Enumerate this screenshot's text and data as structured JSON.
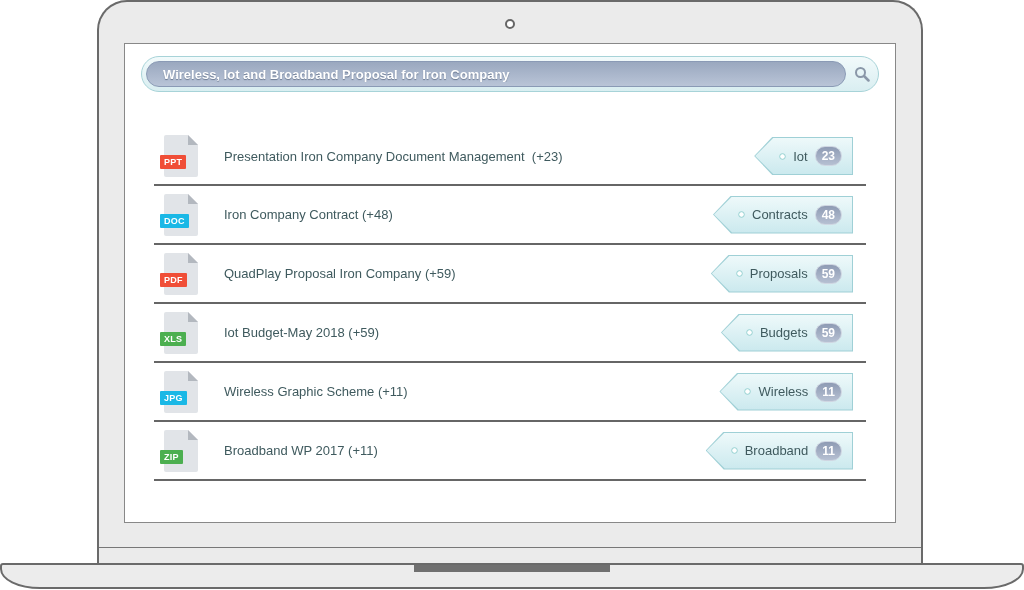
{
  "search": {
    "value": "Wireless, Iot and Broadband Proposal for Iron Company"
  },
  "results": [
    {
      "file_type": "PPT",
      "color": "#f04e37",
      "title": "Presentation Iron Company Document Management  (+23)",
      "tag": "Iot",
      "count": "23"
    },
    {
      "file_type": "DOC",
      "color": "#1ab8e6",
      "title": "Iron Company Contract (+48)",
      "tag": "Contracts",
      "count": "48"
    },
    {
      "file_type": "PDF",
      "color": "#f04e37",
      "title": "QuadPlay Proposal Iron Company (+59)",
      "tag": "Proposals",
      "count": "59"
    },
    {
      "file_type": "XLS",
      "color": "#4caf50",
      "title": "Iot Budget-May 2018 (+59)",
      "tag": "Budgets",
      "count": "59"
    },
    {
      "file_type": "JPG",
      "color": "#1ab8e6",
      "title": "Wireless Graphic Scheme (+11)",
      "tag": "Wireless",
      "count": "11"
    },
    {
      "file_type": "ZIP",
      "color": "#4caf50",
      "title": "Broadband WP 2017 (+11)",
      "tag": "Broadband",
      "count": "11"
    }
  ]
}
